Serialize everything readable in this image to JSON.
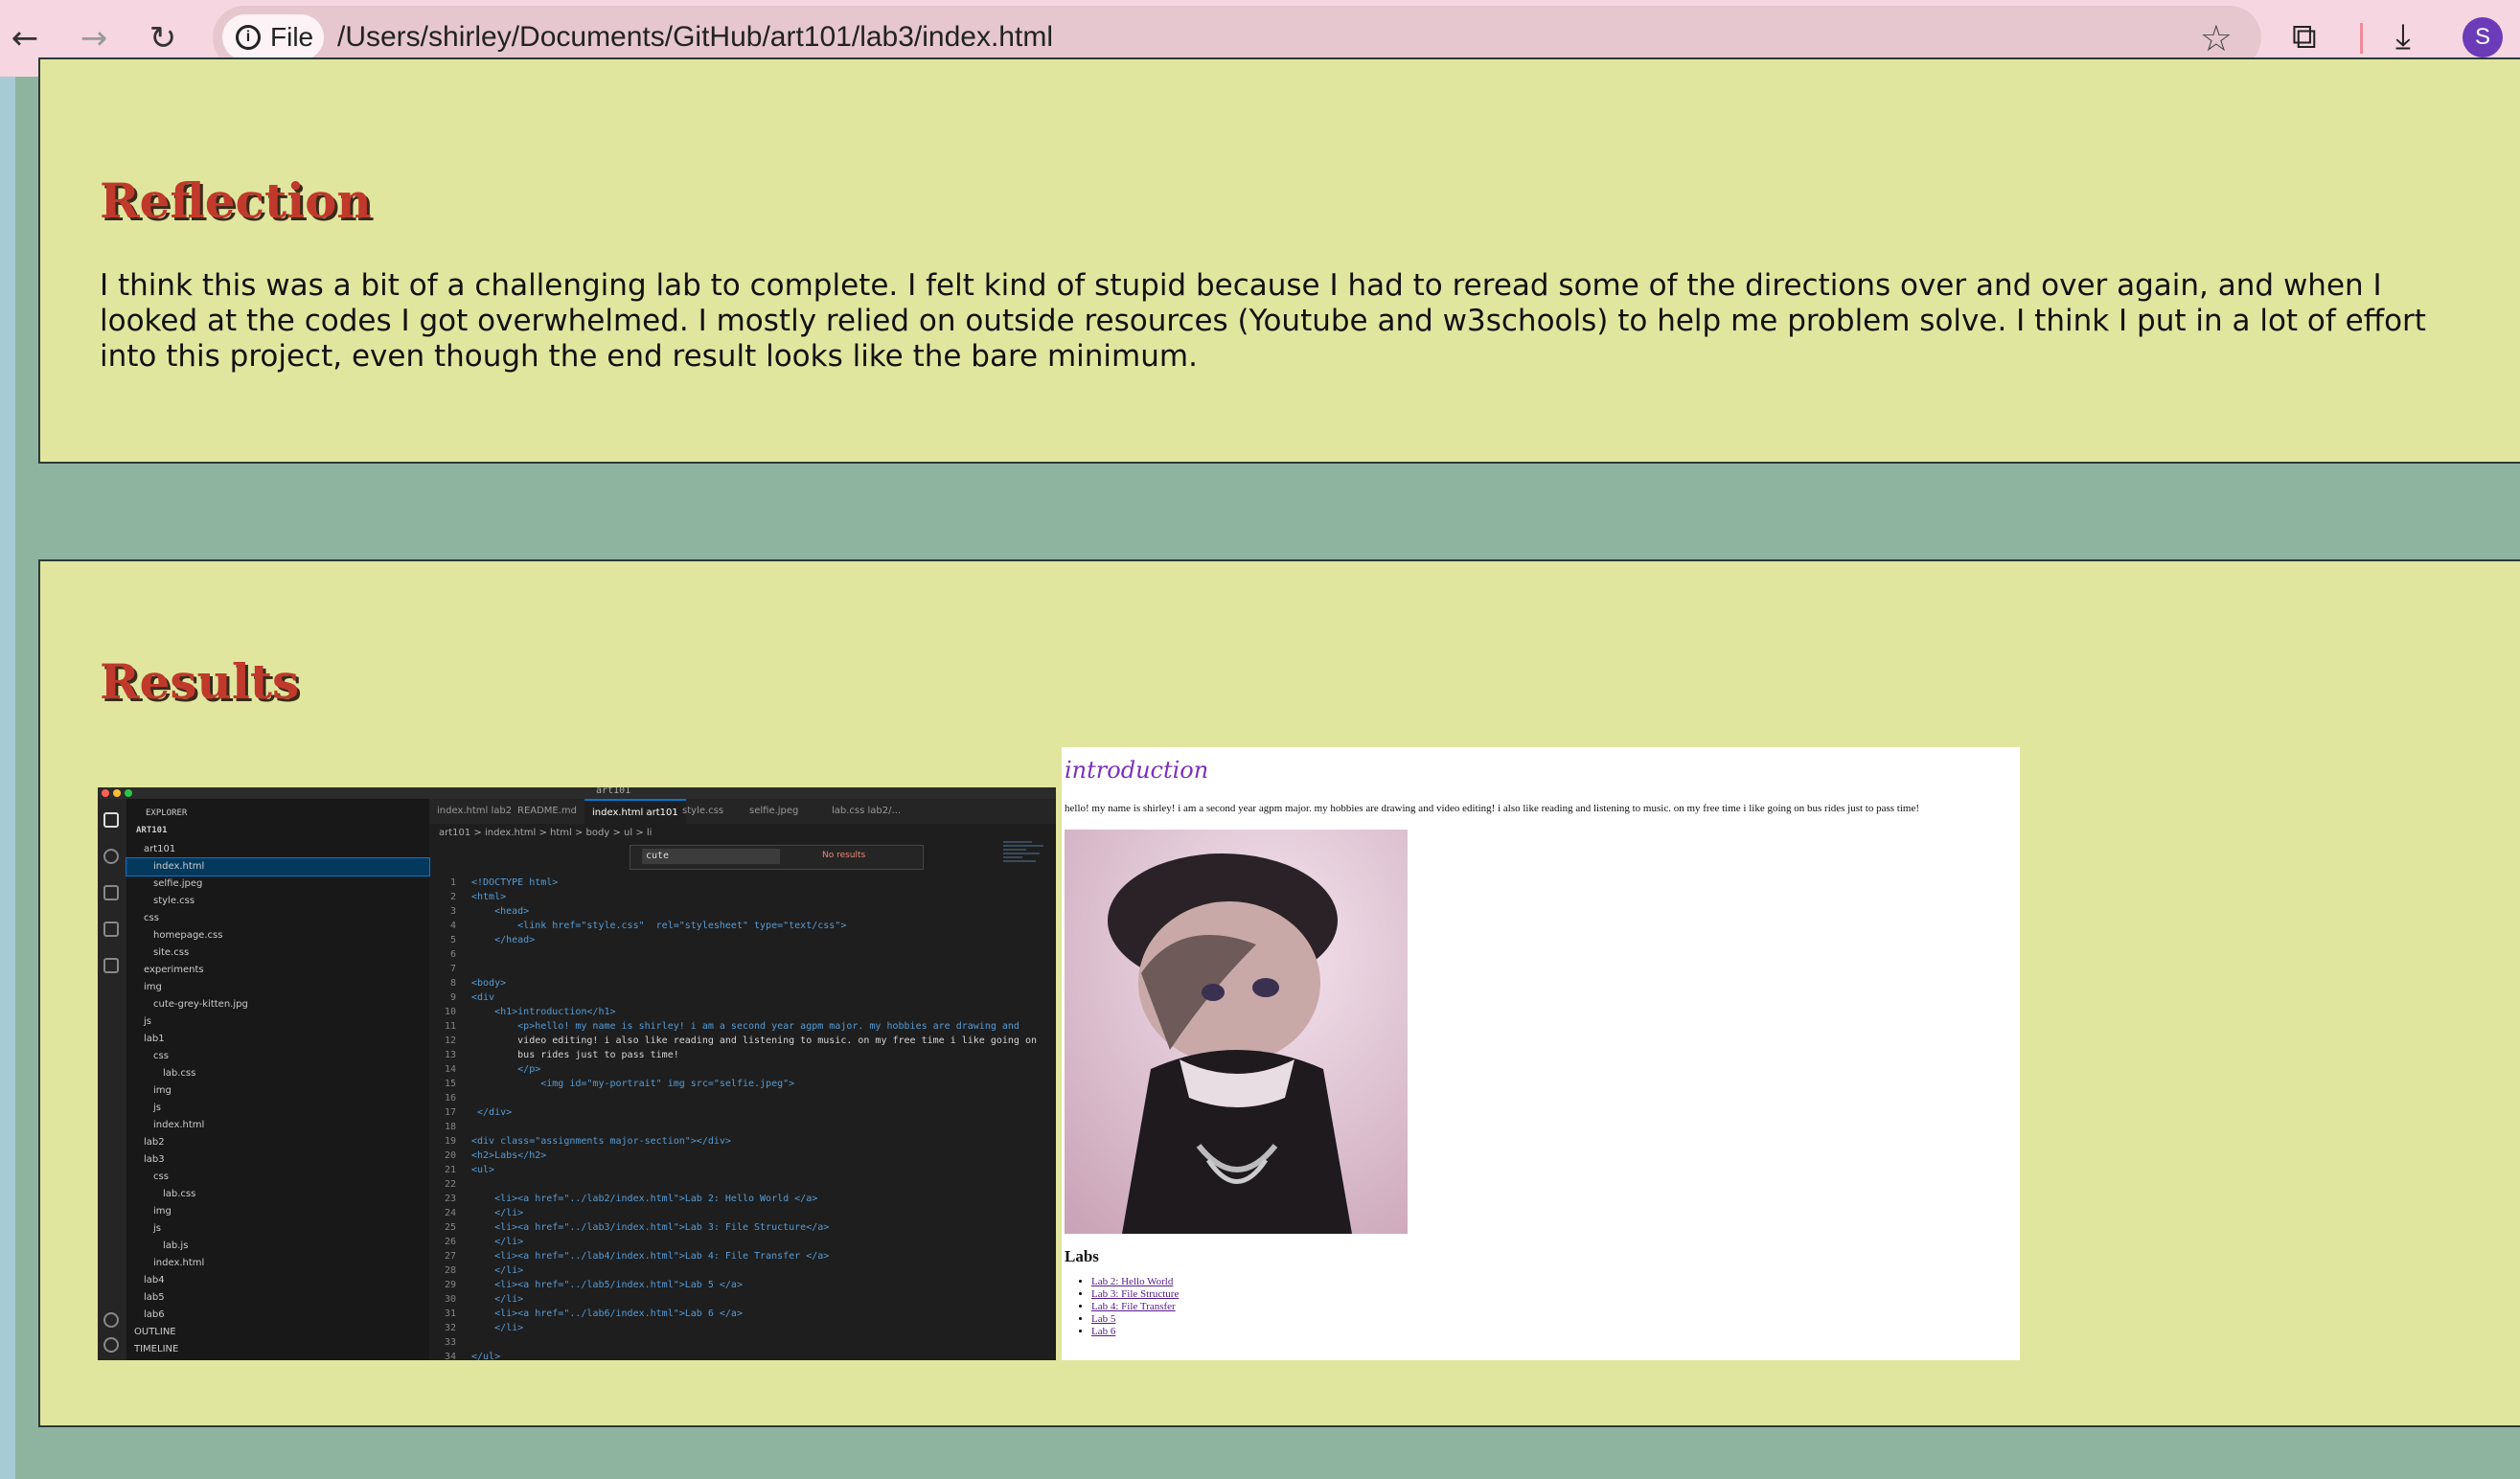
{
  "browser": {
    "site_chip": "File",
    "url": "/Users/shirley/Documents/GitHub/art101/lab3/index.html",
    "avatar_letter": "S"
  },
  "reflection": {
    "title": "Reflection",
    "text": "I think this was a bit of a challenging lab to complete. I felt kind of stupid because I had to reread some of the directions over and over again, and when I looked at the codes I got overwhelmed. I mostly relied on outside resources (Youtube and w3schools) to help me problem solve. I think I put in a lot of effort into this project, even though the end result looks like the bare minimum."
  },
  "results": {
    "title": "Results"
  },
  "vscode": {
    "window_title": "art101",
    "explorer_label": "EXPLORER",
    "root_label": "ART101",
    "tree": [
      "art101",
      "index.html",
      "selfie.jpeg",
      "style.css",
      "css",
      "homepage.css",
      "site.css",
      "experiments",
      "img",
      "cute-grey-kitten.jpg",
      "js",
      "lab1",
      "css",
      "lab.css",
      "img",
      "js",
      "index.html",
      "lab2",
      "lab3",
      "css",
      "lab.css",
      "img",
      "js",
      "lab.js",
      "index.html",
      "lab4",
      "lab5",
      "lab6",
      "OUTLINE",
      "TIMELINE"
    ],
    "tabs": [
      "index.html lab2",
      "README.md",
      "index.html art101",
      "style.css",
      "selfie.jpeg",
      "lab.css lab2/..."
    ],
    "breadcrumb": "art101 > index.html > html > body > ul > li",
    "find_query": "cute",
    "find_result": "No results",
    "code_lines": [
      "<!DOCTYPE html>",
      "<html>",
      "    <head>",
      "        <link href=\"style.css\"  rel=\"stylesheet\" type=\"text/css\">",
      "    </head>",
      "",
      "",
      "<body>",
      "<div",
      "    <h1>introduction</h1>",
      "        <p>hello! my name is shirley! i am a second year agpm major. my hobbies are drawing and",
      "        video editing! i also like reading and listening to music. on my free time i like going on",
      "        bus rides just to pass time!",
      "        </p>",
      "            <img id=\"my-portrait\" img src=\"selfie.jpeg\">",
      "",
      " </div>",
      "",
      "<div class=\"assignments major-section\"></div>",
      "<h2>Labs</h2>",
      "<ul>",
      "",
      "    <li><a href=\"../lab2/index.html\">Lab 2: Hello World </a>",
      "    </li>",
      "    <li><a href=\"../lab3/index.html\">Lab 3: File Structure</a>",
      "    </li>",
      "    <li><a href=\"../lab4/index.html\">Lab 4: File Transfer </a>",
      "    </li>",
      "    <li><a href=\"../lab5/index.html\">Lab 5 </a>",
      "    </li>",
      "    <li><a href=\"../lab6/index.html\">Lab 6 </a>",
      "    </li>",
      "",
      "</ul>"
    ]
  },
  "preview": {
    "heading": "introduction",
    "paragraph": "hello! my name is shirley! i am a second year agpm major. my hobbies are drawing and video editing! i also like reading and listening to music. on my free time i like going on bus rides just to pass time!",
    "labs_heading": "Labs",
    "links": [
      "Lab 2: Hello World",
      "Lab 3: File Structure",
      "Lab 4: File Transfer",
      "Lab 5",
      "Lab 6"
    ]
  },
  "colors": {
    "section_bg": "#e1e69e",
    "page_bg": "#8eb39f",
    "title_red": "#c0392b",
    "browser_chrome": "#f6d6e0"
  }
}
